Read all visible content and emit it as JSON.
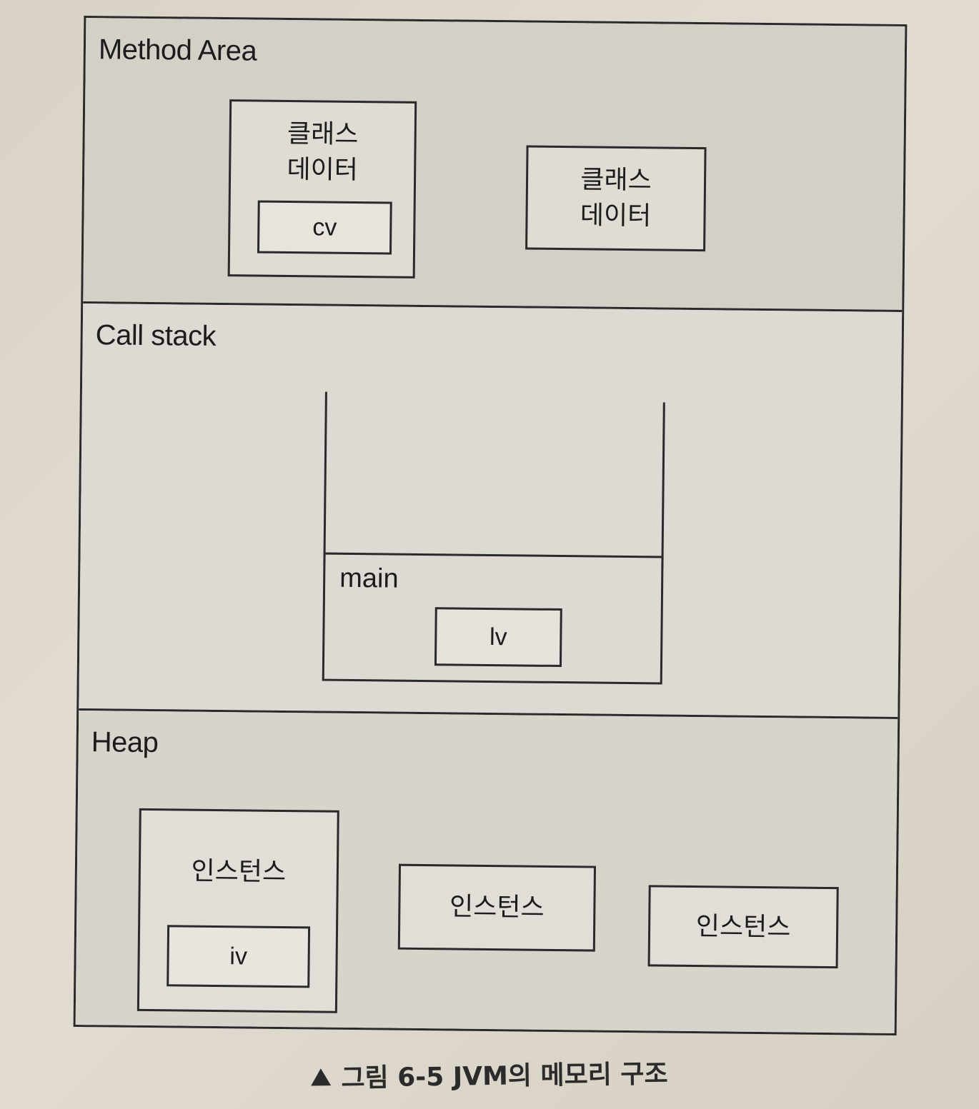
{
  "method_area": {
    "title": "Method Area",
    "class_data_1": {
      "label": "클래스\n데이터",
      "inner": "cv"
    },
    "class_data_2": {
      "label": "클래스\n데이터"
    }
  },
  "call_stack": {
    "title": "Call stack",
    "frame": {
      "label": "main",
      "inner": "lv"
    }
  },
  "heap": {
    "title": "Heap",
    "instance_1": {
      "label": "인스턴스",
      "inner": "iv"
    },
    "instance_2": {
      "label": "인스턴스"
    },
    "instance_3": {
      "label": "인스턴스"
    }
  },
  "caption": {
    "text": "그림 6-5  JVM의 메모리 구조"
  }
}
